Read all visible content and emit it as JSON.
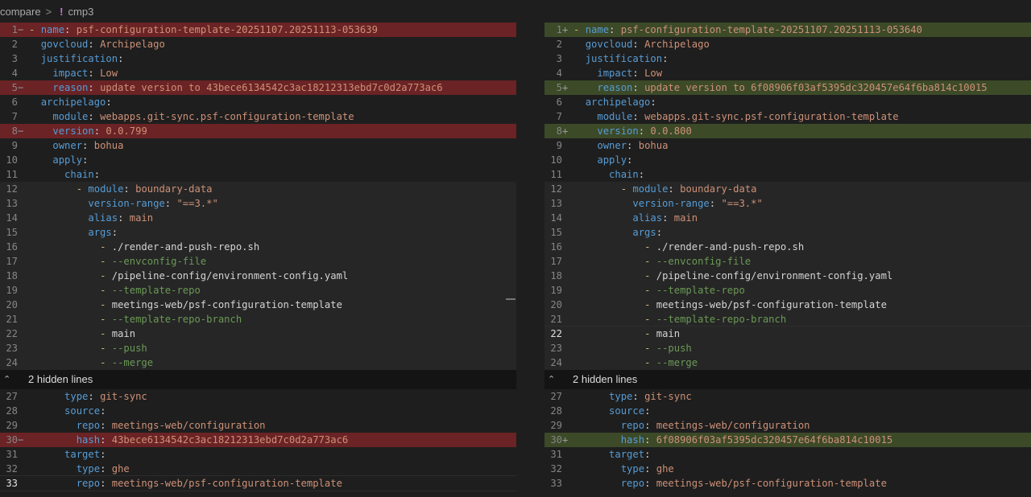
{
  "breadcrumb": {
    "root": "compare",
    "sep": ">",
    "icon": "!",
    "file": "cmp3"
  },
  "hidden": {
    "left": "2 hidden lines",
    "right": "2 hidden lines"
  },
  "left": {
    "top": [
      {
        "n": "1",
        "m": "−",
        "t": "- name: psf-configuration-template-20251107.20251113-053639"
      },
      {
        "n": "2",
        "m": "",
        "t": "  govcloud: Archipelago"
      },
      {
        "n": "3",
        "m": "",
        "t": "  justification:"
      },
      {
        "n": "4",
        "m": "",
        "t": "    impact: Low"
      },
      {
        "n": "5",
        "m": "−",
        "t": "    reason: update version to 43bece6134542c3ac18212313ebd7c0d2a773ac6"
      },
      {
        "n": "6",
        "m": "",
        "t": "  archipelago:"
      },
      {
        "n": "7",
        "m": "",
        "t": "    module: webapps.git-sync.psf-configuration-template"
      },
      {
        "n": "8",
        "m": "−",
        "t": "    version: 0.0.799"
      },
      {
        "n": "9",
        "m": "",
        "t": "    owner: bohua"
      },
      {
        "n": "10",
        "m": "",
        "t": "    apply:"
      },
      {
        "n": "11",
        "m": "",
        "t": "      chain:"
      },
      {
        "n": "12",
        "m": "",
        "t": "        - module: boundary-data"
      },
      {
        "n": "13",
        "m": "",
        "t": "          version-range: \"==3.*\""
      },
      {
        "n": "14",
        "m": "",
        "t": "          alias: main"
      },
      {
        "n": "15",
        "m": "",
        "t": "          args:"
      },
      {
        "n": "16",
        "m": "",
        "t": "            - ./render-and-push-repo.sh"
      },
      {
        "n": "17",
        "m": "",
        "t": "            - --envconfig-file"
      },
      {
        "n": "18",
        "m": "",
        "t": "            - /pipeline-config/environment-config.yaml"
      },
      {
        "n": "19",
        "m": "",
        "t": "            - --template-repo"
      },
      {
        "n": "20",
        "m": "",
        "t": "            - meetings-web/psf-configuration-template"
      },
      {
        "n": "21",
        "m": "",
        "t": "            - --template-repo-branch"
      },
      {
        "n": "22",
        "m": "",
        "t": "            - main"
      },
      {
        "n": "23",
        "m": "",
        "t": "            - --push"
      },
      {
        "n": "24",
        "m": "",
        "t": "            - --merge"
      }
    ],
    "bottom": [
      {
        "n": "27",
        "m": "",
        "t": "      type: git-sync"
      },
      {
        "n": "28",
        "m": "",
        "t": "      source:"
      },
      {
        "n": "29",
        "m": "",
        "t": "        repo: meetings-web/configuration"
      },
      {
        "n": "30",
        "m": "−",
        "t": "        hash: 43bece6134542c3ac18212313ebd7c0d2a773ac6"
      },
      {
        "n": "31",
        "m": "",
        "t": "      target:"
      },
      {
        "n": "32",
        "m": "",
        "t": "        type: ghe"
      },
      {
        "n": "33",
        "m": "",
        "t": "        repo: meetings-web/psf-configuration-template"
      }
    ]
  },
  "right": {
    "top": [
      {
        "n": "1",
        "m": "+",
        "t": "- name: psf-configuration-template-20251107.20251113-053640"
      },
      {
        "n": "2",
        "m": "",
        "t": "  govcloud: Archipelago"
      },
      {
        "n": "3",
        "m": "",
        "t": "  justification:"
      },
      {
        "n": "4",
        "m": "",
        "t": "    impact: Low"
      },
      {
        "n": "5",
        "m": "+",
        "t": "    reason: update version to 6f08906f03af5395dc320457e64f6ba814c10015"
      },
      {
        "n": "6",
        "m": "",
        "t": "  archipelago:"
      },
      {
        "n": "7",
        "m": "",
        "t": "    module: webapps.git-sync.psf-configuration-template"
      },
      {
        "n": "8",
        "m": "+",
        "t": "    version: 0.0.800"
      },
      {
        "n": "9",
        "m": "",
        "t": "    owner: bohua"
      },
      {
        "n": "10",
        "m": "",
        "t": "    apply:"
      },
      {
        "n": "11",
        "m": "",
        "t": "      chain:"
      },
      {
        "n": "12",
        "m": "",
        "t": "        - module: boundary-data"
      },
      {
        "n": "13",
        "m": "",
        "t": "          version-range: \"==3.*\""
      },
      {
        "n": "14",
        "m": "",
        "t": "          alias: main"
      },
      {
        "n": "15",
        "m": "",
        "t": "          args:"
      },
      {
        "n": "16",
        "m": "",
        "t": "            - ./render-and-push-repo.sh"
      },
      {
        "n": "17",
        "m": "",
        "t": "            - --envconfig-file"
      },
      {
        "n": "18",
        "m": "",
        "t": "            - /pipeline-config/environment-config.yaml"
      },
      {
        "n": "19",
        "m": "",
        "t": "            - --template-repo"
      },
      {
        "n": "20",
        "m": "",
        "t": "            - meetings-web/psf-configuration-template"
      },
      {
        "n": "21",
        "m": "",
        "t": "            - --template-repo-branch"
      },
      {
        "n": "22",
        "m": "",
        "t": "            - main"
      },
      {
        "n": "23",
        "m": "",
        "t": "            - --push"
      },
      {
        "n": "24",
        "m": "",
        "t": "            - --merge"
      }
    ],
    "bottom": [
      {
        "n": "27",
        "m": "",
        "t": "      type: git-sync"
      },
      {
        "n": "28",
        "m": "",
        "t": "      source:"
      },
      {
        "n": "29",
        "m": "",
        "t": "        repo: meetings-web/configuration"
      },
      {
        "n": "30",
        "m": "+",
        "t": "        hash: 6f08906f03af5395dc320457e64f6ba814c10015"
      },
      {
        "n": "31",
        "m": "",
        "t": "      target:"
      },
      {
        "n": "32",
        "m": "",
        "t": "        type: ghe"
      },
      {
        "n": "33",
        "m": "",
        "t": "        repo: meetings-web/psf-configuration-template"
      }
    ]
  },
  "colors": {
    "deleted_bg": "#6b2325",
    "inserted_bg": "#3c4a28",
    "key": "#569cd6",
    "string": "#ce9178",
    "comment_green": "#6a9955"
  }
}
